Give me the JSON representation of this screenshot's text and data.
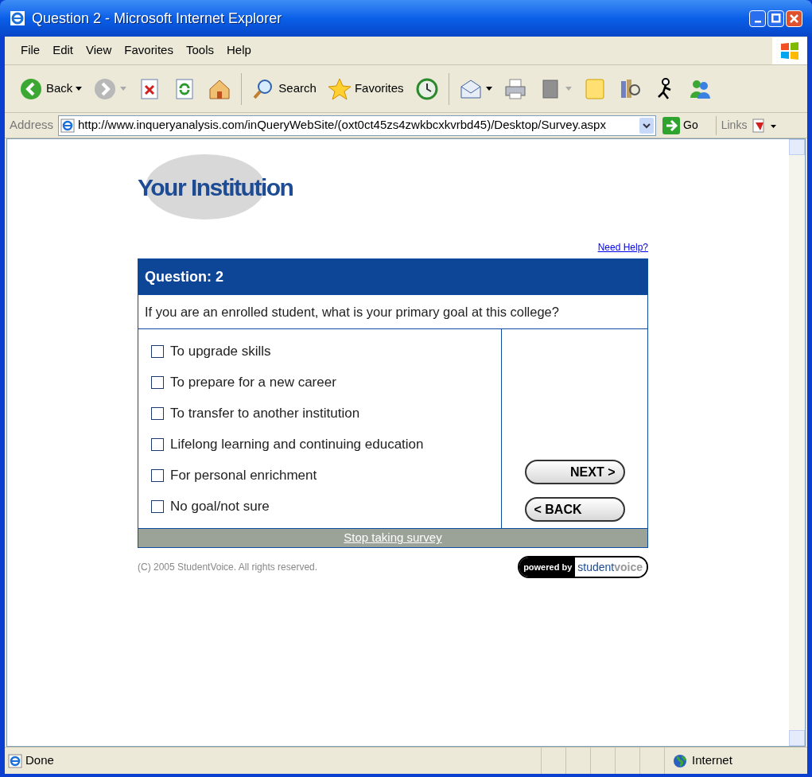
{
  "window": {
    "title": "Question 2 - Microsoft Internet Explorer"
  },
  "menu": [
    "File",
    "Edit",
    "View",
    "Favorites",
    "Tools",
    "Help"
  ],
  "toolbar": [
    {
      "kind": "back",
      "label": "Back"
    },
    {
      "kind": "forward"
    },
    {
      "kind": "stop"
    },
    {
      "kind": "refresh"
    },
    {
      "kind": "home"
    },
    {
      "kind": "search",
      "label": "Search"
    },
    {
      "kind": "favorites",
      "label": "Favorites"
    },
    {
      "kind": "history"
    },
    {
      "kind": "mail"
    },
    {
      "kind": "print"
    },
    {
      "kind": "edit"
    },
    {
      "kind": "note"
    },
    {
      "kind": "research"
    },
    {
      "kind": "messenger"
    },
    {
      "kind": "people"
    }
  ],
  "address": {
    "label": "Address",
    "url": "http://www.inqueryanalysis.com/inQueryWebSite/(oxt0ct45zs4zwkbcxkvrbd45)/Desktop/Survey.aspx",
    "go": "Go",
    "links": "Links"
  },
  "page": {
    "logo": "Your Institution",
    "help_link": "Need Help?",
    "question_title": "Question: 2",
    "question": "If you are an enrolled student, what is your primary goal at this college?",
    "options": [
      {
        "label": "To upgrade skills",
        "checked": false
      },
      {
        "label": "To prepare for a new career",
        "checked": false
      },
      {
        "label": "To transfer to another institution",
        "checked": false
      },
      {
        "label": "Lifelong learning and continuing education",
        "checked": false
      },
      {
        "label": "For personal enrichment",
        "checked": false
      },
      {
        "label": "No goal/not sure",
        "checked": false
      }
    ],
    "buttons": [
      {
        "kind": "next",
        "label": "NEXT",
        "arrow": ">"
      },
      {
        "kind": "back",
        "label": "BACK",
        "arrow": "<"
      }
    ],
    "stop_link": "Stop taking survey",
    "copyright": "(C) 2005 StudentVoice. All rights reserved.",
    "badge": {
      "prefix": "powered by",
      "brand_a": "student",
      "brand_b": "voice"
    }
  },
  "status_bar": {
    "text": "Done",
    "zone": "Internet"
  }
}
